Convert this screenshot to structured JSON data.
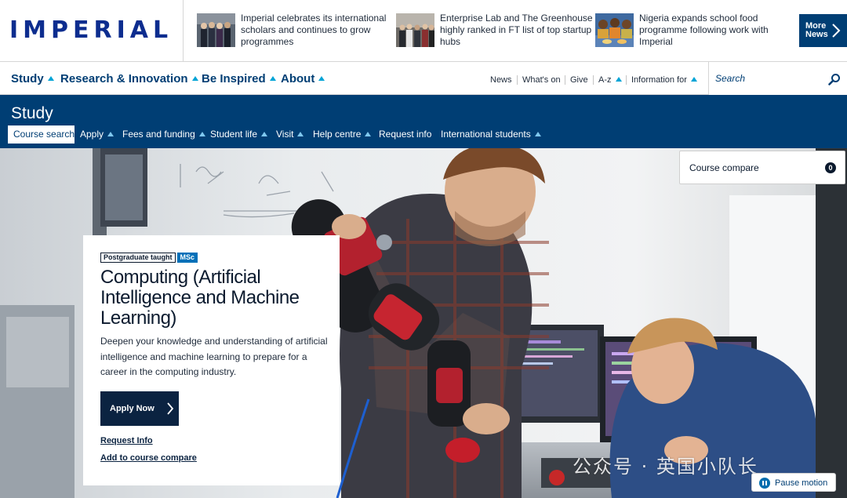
{
  "brand": {
    "logo_text": "IMPERIAL"
  },
  "news": [
    {
      "text": "Imperial celebrates its international scholars and continues to grow programmes",
      "thumb": "group-photo-thumbnail"
    },
    {
      "text": "Enterprise Lab and The Greenhouse highly ranked in FT list of top startup hubs",
      "thumb": "event-photo-thumbnail"
    },
    {
      "text": "Nigeria expands school food programme following work with Imperial",
      "thumb": "children-photo-thumbnail"
    }
  ],
  "more_news": {
    "line1": "More",
    "line2": "News"
  },
  "main_nav": [
    "Study",
    "Research & Innovation",
    "Be Inspired",
    "About"
  ],
  "utility_nav": [
    "News",
    "What's on",
    "Give",
    "A-z",
    "Information for"
  ],
  "search": {
    "placeholder": "Search"
  },
  "study": {
    "title": "Study",
    "nav": [
      "Course search",
      "Apply",
      "Fees and funding",
      "Student life",
      "Visit",
      "Help centre",
      "Request info",
      "International students"
    ]
  },
  "compare": {
    "label": "Course compare",
    "count": "0"
  },
  "course": {
    "tag_level": "Postgraduate taught",
    "tag_degree": "MSc",
    "title": "Computing (Artificial Intelligence and Machine Learning)",
    "description": "Deepen your knowledge and understanding of artificial intelligence and machine learning to prepare for a career in the computing industry.",
    "apply_label": "Apply Now",
    "request_info": "Request Info",
    "add_compare": "Add to course compare"
  },
  "watermark": "公众号 · 英国小队长",
  "pause": {
    "label": "Pause motion"
  },
  "colors": {
    "navy": "#003e74",
    "accent": "#00a4d6",
    "logo": "#0d2d8f",
    "dark": "#0b2341",
    "msc": "#0070b8"
  }
}
